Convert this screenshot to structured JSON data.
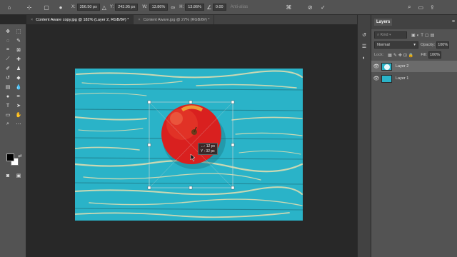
{
  "options_bar": {
    "x_label": "X:",
    "x_value": "356.50 px",
    "y_label": "Y:",
    "y_value": "243.95 px",
    "w_label": "W:",
    "w_value": "13.86%",
    "h_label": "H:",
    "h_value": "13.86%",
    "angle_value": "0.00",
    "antialias_label": "Anti-alias"
  },
  "tabs": [
    {
      "label": "Content Aware copy.jpg @ 182% (Layer 2, RGB/8#) *",
      "close": "×",
      "active": true
    },
    {
      "label": "Content Aware.jpg @ 27% (RGB/8#) *",
      "close": "×",
      "active": false
    }
  ],
  "transform_readout": {
    "line1": "↔: 12 px",
    "line2": "Y : 32 px"
  },
  "layers_panel": {
    "title": "Layers",
    "kind_placeholder": "Kind",
    "blend_mode": "Normal",
    "opacity_label": "Opacity:",
    "opacity_value": "100%",
    "lock_label": "Lock:",
    "fill_label": "Fill:",
    "fill_value": "100%",
    "layers": [
      {
        "name": "Layer 2",
        "selected": true
      },
      {
        "name": "Layer 1",
        "selected": false
      }
    ]
  },
  "colors": {
    "foreground": "#000000",
    "background": "#ffffff",
    "accent": "#2bb4c9"
  }
}
